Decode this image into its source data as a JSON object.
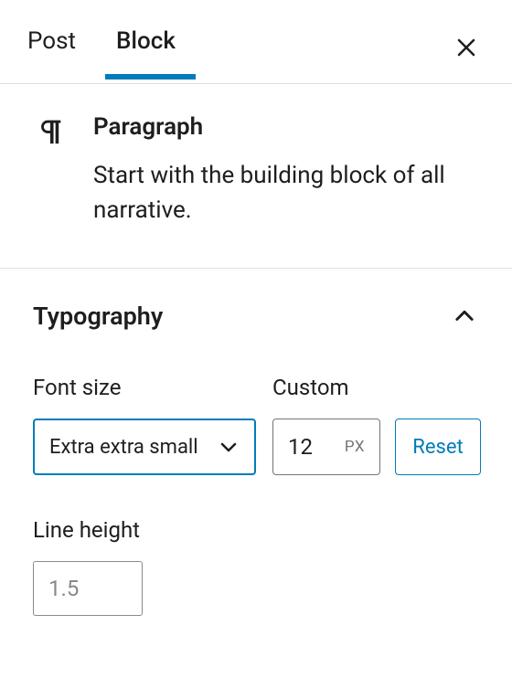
{
  "tabs": {
    "post": "Post",
    "block": "Block"
  },
  "block": {
    "title": "Paragraph",
    "description": "Start with the building block of all narrative."
  },
  "typography": {
    "title": "Typography",
    "fontSize": {
      "label": "Font size",
      "selected": "Extra extra small"
    },
    "custom": {
      "label": "Custom",
      "value": "12",
      "unit": "PX"
    },
    "reset": "Reset",
    "lineHeight": {
      "label": "Line height",
      "placeholder": "1.5"
    }
  }
}
